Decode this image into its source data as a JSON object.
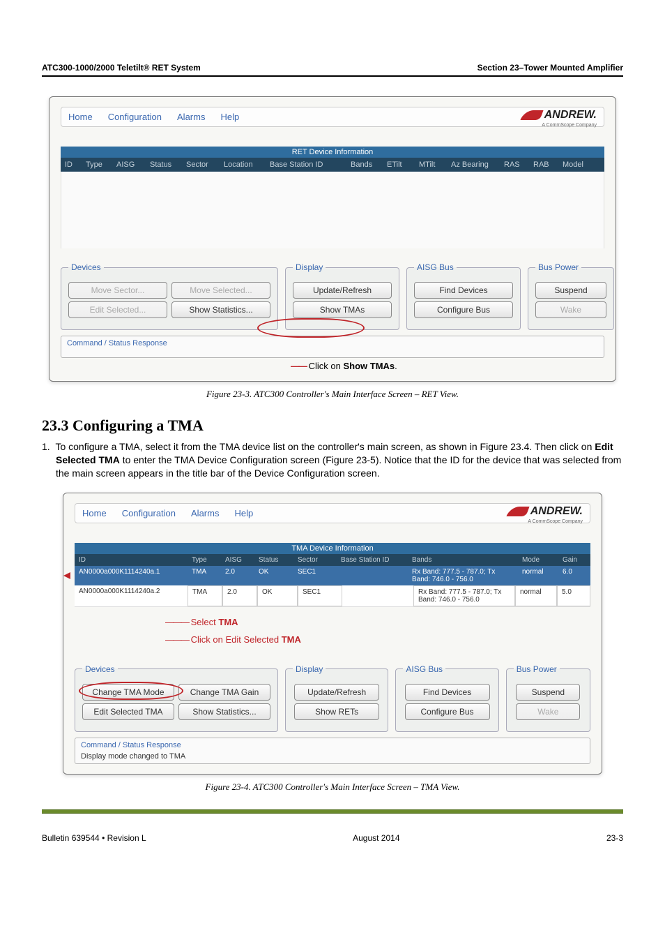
{
  "doc_header_left": "ATC300-1000/2000 Teletilt® RET System",
  "doc_header_right": "Section 23–Tower Mounted Amplifier",
  "fig1": {
    "menu": {
      "home": "Home",
      "config": "Configuration",
      "alarms": "Alarms",
      "help": "Help"
    },
    "logo_text": "ANDREW.",
    "logo_sub": "A CommScope Company",
    "band_title": "RET Device Information",
    "cols": [
      "ID",
      "Type",
      "AISG",
      "Status",
      "Sector",
      "Location",
      "Base Station ID",
      "Bands",
      "ETilt",
      "MTilt",
      "Az Bearing",
      "RAS",
      "RAB",
      "Model"
    ],
    "panels": {
      "devices": {
        "legend": "Devices",
        "move_sector": "Move Sector...",
        "move_selected": "Move Selected...",
        "edit_selected": "Edit Selected...",
        "show_stats": "Show Statistics..."
      },
      "display": {
        "legend": "Display",
        "update": "Update/Refresh",
        "show_tmas": "Show TMAs"
      },
      "aisg": {
        "legend": "AISG Bus",
        "find": "Find Devices",
        "configure": "Configure Bus"
      },
      "power": {
        "legend": "Bus Power",
        "suspend": "Suspend",
        "wake": "Wake"
      }
    },
    "status_label": "Command / Status Response",
    "callout_prefix": "Click on ",
    "callout_bold": "Show TMAs",
    "callout_suffix": ".",
    "caption": "Figure 23-3.  ATC300 Controller's Main Interface Screen – RET View."
  },
  "section_heading": "23.3 Configuring a TMA",
  "body_para": "1.  To configure a TMA, select it from the TMA device list on the controller's main screen, as shown in Figure 23.4. Then click on Edit Selected TMA to enter the TMA Device Configuration screen (Figure 23-5). Notice that the ID for the device that was selected from the main screen appears in the title bar of the Device Configuration screen.",
  "body_bold": "Edit Selected TMA",
  "fig2": {
    "menu": {
      "home": "Home",
      "config": "Configuration",
      "alarms": "Alarms",
      "help": "Help"
    },
    "logo_text": "ANDREW.",
    "logo_sub": "A CommScope Company",
    "band_title": "TMA Device Information",
    "cols": {
      "id": "ID",
      "type": "Type",
      "aisg": "AISG",
      "status": "Status",
      "sector": "Sector",
      "base": "Base Station ID",
      "bands": "Bands",
      "mode": "Mode",
      "gain": "Gain"
    },
    "row1": {
      "id": "AN0000a000K1114240a.1",
      "type": "TMA",
      "aisg": "2.0",
      "status": "OK",
      "sector": "SEC1",
      "bands": "Rx Band: 777.5 - 787.0; Tx Band: 746.0 - 756.0",
      "mode": "normal",
      "gain": "6.0"
    },
    "row2": {
      "id": "AN0000a000K1114240a.2",
      "type": "TMA",
      "aisg": "2.0",
      "status": "OK",
      "sector": "SEC1",
      "bands": "Rx Band: 777.5 - 787.0; Tx Band: 746.0 - 756.0",
      "mode": "normal",
      "gain": "5.0"
    },
    "annot_select_prefix": "Select ",
    "annot_select_bold": "TMA",
    "annot_click_prefix": "Click on Edit Selected ",
    "annot_click_bold": "TMA",
    "panels": {
      "devices": {
        "legend": "Devices",
        "change": "Change TMA Mode",
        "gain": "Change TMA Gain",
        "edit": "Edit Selected TMA",
        "stats": "Show Statistics..."
      },
      "display": {
        "legend": "Display",
        "update": "Update/Refresh",
        "show": "Show RETs"
      },
      "aisg": {
        "legend": "AISG Bus",
        "find": "Find Devices",
        "conf": "Configure Bus"
      },
      "power": {
        "legend": "Bus Power",
        "suspend": "Suspend",
        "wake": "Wake"
      }
    },
    "status_label": "Command / Status Response",
    "status_text": "Display mode changed to TMA",
    "caption": "Figure 23-4.  ATC300 Controller's Main Interface Screen – TMA View."
  },
  "footer": {
    "left": "Bulletin 639544  •  Revision L",
    "center": "August 2014",
    "right": "23-3"
  }
}
